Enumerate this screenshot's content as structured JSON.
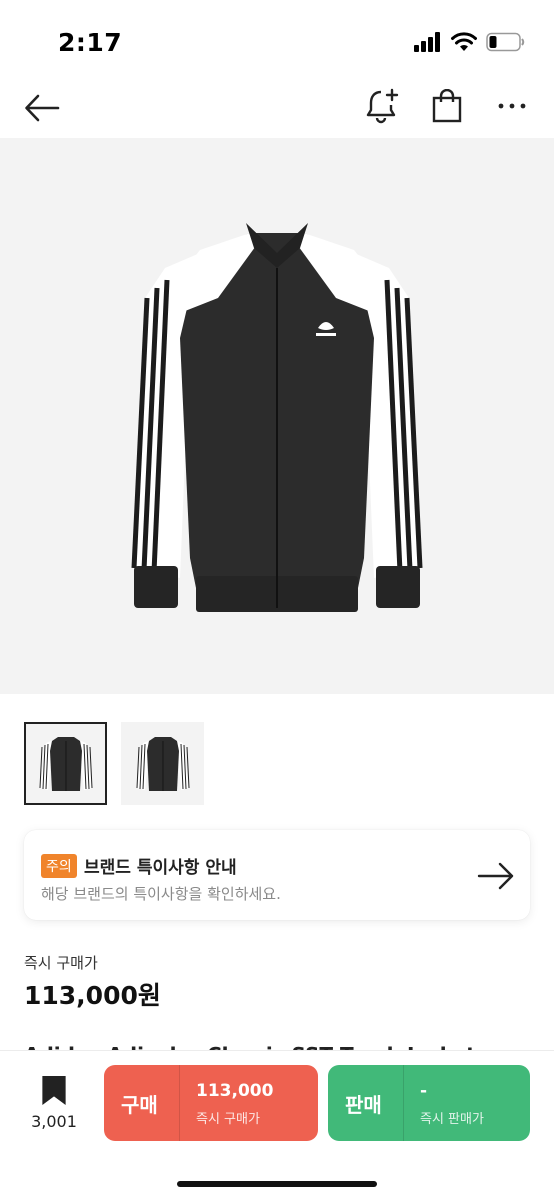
{
  "status_bar": {
    "time": "2:17"
  },
  "notice": {
    "badge": "주의",
    "title": "브랜드 특이사항 안내",
    "subtitle": "해당 브랜드의 특이사항을 확인하세요."
  },
  "price": {
    "label": "즉시 구매가",
    "value": "113,000원"
  },
  "product": {
    "title_partial": "Adidas Adicolor Classic SST Track Jacket"
  },
  "bottom_bar": {
    "bookmark_count": "3,001",
    "buy": {
      "label": "구매",
      "price": "113,000",
      "sub": "즉시 구매가",
      "color": "#ee6150"
    },
    "sell": {
      "label": "판매",
      "price": "-",
      "sub": "즉시 판매가",
      "color": "#41b979"
    }
  },
  "colors": {
    "accent": "#f0842b",
    "buy": "#ee6150",
    "sell": "#41b979"
  },
  "icons": [
    "back-arrow-icon",
    "alarm-add-icon",
    "shopping-bag-icon",
    "more-icon",
    "right-arrow-icon",
    "bookmark-icon",
    "signal-icon",
    "wifi-icon",
    "battery-icon"
  ]
}
